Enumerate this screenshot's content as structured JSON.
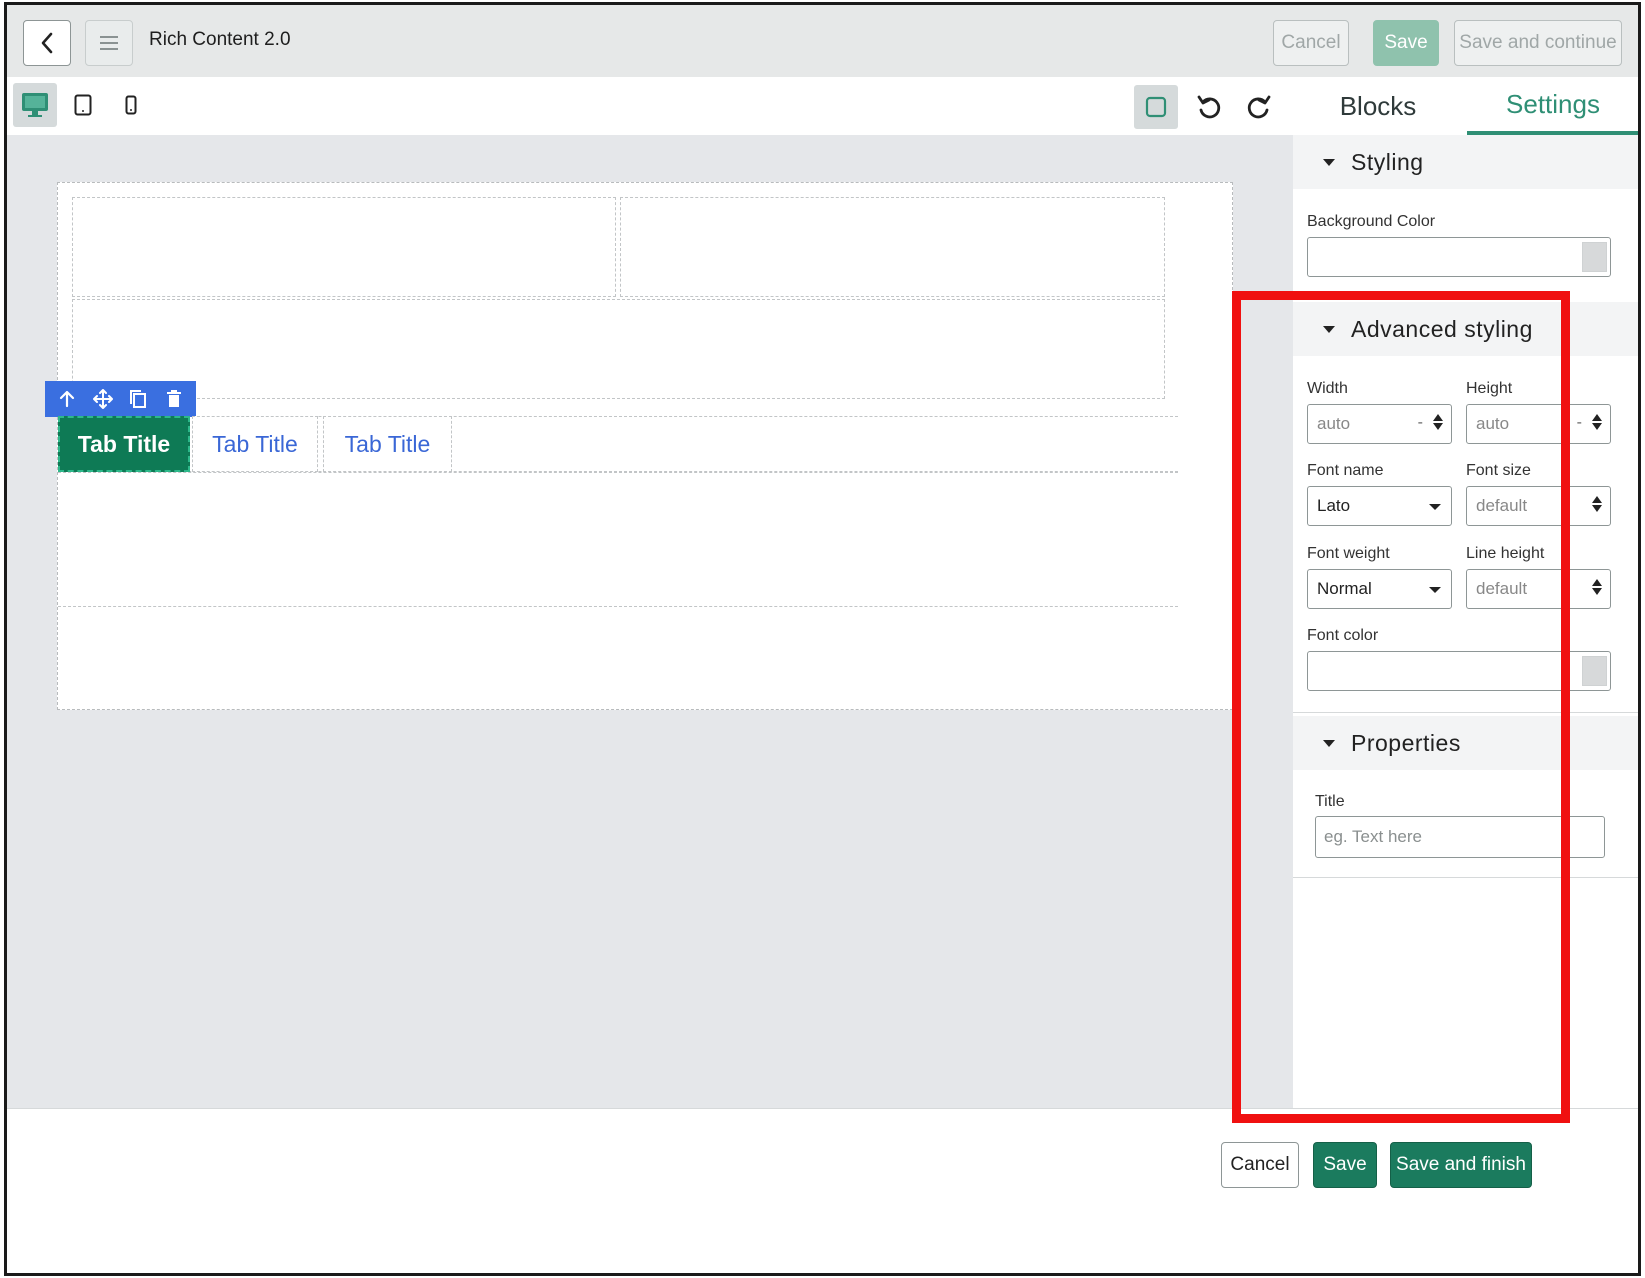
{
  "header": {
    "title": "Rich Content 2.0",
    "cancel_label": "Cancel",
    "save_label": "Save",
    "save_continue_label": "Save and continue"
  },
  "toolbar": {
    "device_icons": [
      "desktop-icon",
      "tablet-icon",
      "mobile-icon"
    ],
    "active_device": "desktop"
  },
  "right_tabs": {
    "blocks_label": "Blocks",
    "settings_label": "Settings",
    "active": "Settings"
  },
  "canvas": {
    "tabs": [
      {
        "label": "Tab Title",
        "active": true
      },
      {
        "label": "Tab Title",
        "active": false
      },
      {
        "label": "Tab Title",
        "active": false
      }
    ]
  },
  "settings": {
    "styling": {
      "heading": "Styling",
      "background_color_label": "Background Color"
    },
    "advanced": {
      "heading": "Advanced styling",
      "width_label": "Width",
      "width_value": "auto",
      "height_label": "Height",
      "height_value": "auto",
      "font_name_label": "Font name",
      "font_name_value": "Lato",
      "font_size_label": "Font size",
      "font_size_value": "default",
      "font_weight_label": "Font weight",
      "font_weight_value": "Normal",
      "line_height_label": "Line height",
      "line_height_value": "default",
      "font_color_label": "Font color"
    },
    "properties": {
      "heading": "Properties",
      "title_label": "Title",
      "title_placeholder": "eg. Text here"
    }
  },
  "footer": {
    "cancel_label": "Cancel",
    "save_label": "Save",
    "save_finish_label": "Save and finish"
  },
  "colors": {
    "accent": "#2f8f75",
    "primary_button": "#1b7b5e",
    "active_tab": "#0e7a55",
    "tab_link": "#3a67d6",
    "block_toolbar": "#3a6fe0",
    "highlight": "#f01010"
  }
}
